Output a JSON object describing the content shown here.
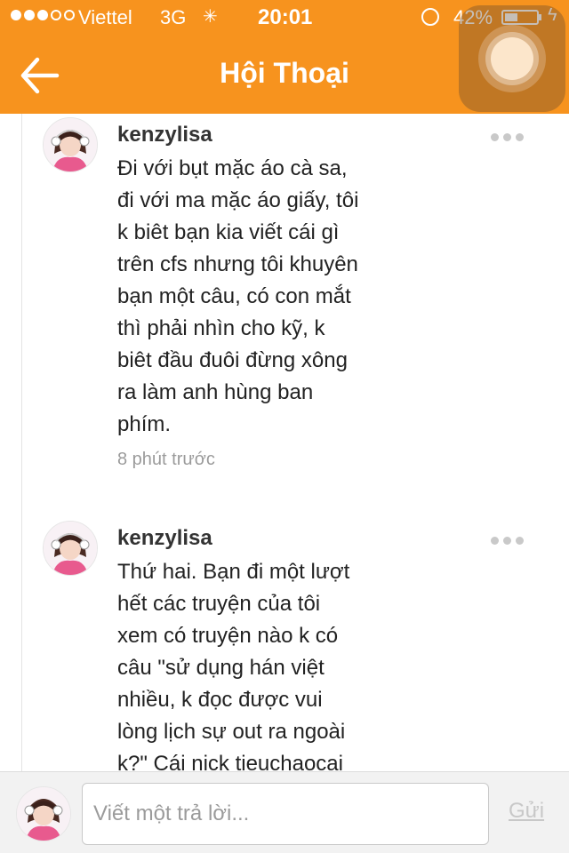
{
  "status_bar": {
    "carrier": "Viettel",
    "network": "3G",
    "time": "20:01",
    "battery_percent_text": "42%",
    "battery_level": 0.42,
    "signal_bars_filled": 3,
    "signal_bars_total": 5
  },
  "header": {
    "title": "Hội Thoại",
    "back_icon": "back-arrow-icon",
    "color": "#f7931e"
  },
  "comments": [
    {
      "username": "kenzylisa",
      "text": "Đi với bụt mặc áo cà sa,\nđi với ma mặc áo giấy, tôi\nk biêt bạn kia viết cái gì\ntrên cfs nhưng tôi khuyên\nbạn một câu, có con mắt\nthì phải nhìn cho kỹ, k\nbiêt đầu đuôi đừng xông\nra làm anh hùng ban\nphím.",
      "time": "8 phút trước"
    },
    {
      "username": "kenzylisa",
      "text": "Thứ hai. Bạn đi một lượt\nhết các truyện của tôi\nxem có truyện nào k có\ncâu \"sử dụng hán việt\nnhiều, k đọc được vui\nlòng lịch sự out ra ngoài\nk?\" Cái nick tieuchaocai",
      "time": ""
    }
  ],
  "composer": {
    "placeholder": "Viết một trả lời...",
    "value": "",
    "send_label": "Gửi"
  }
}
